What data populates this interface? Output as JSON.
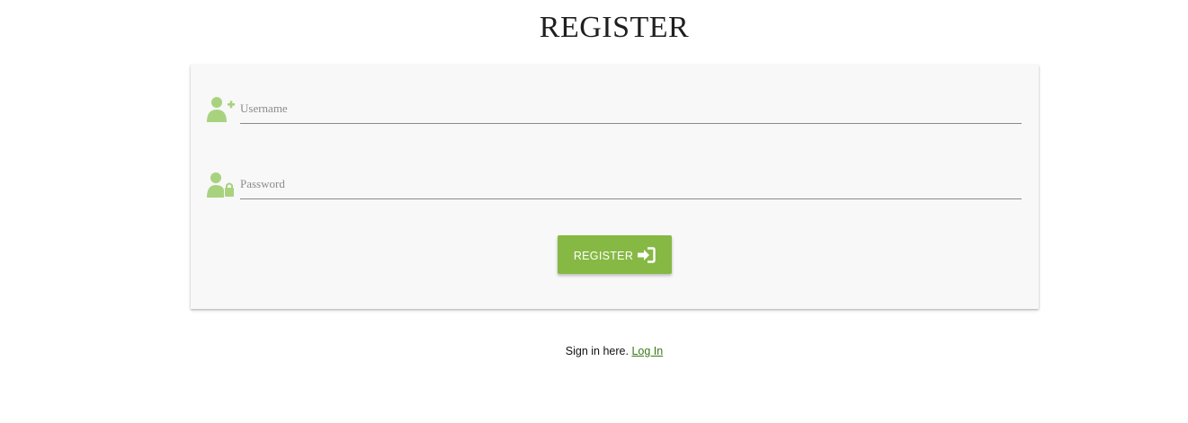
{
  "page": {
    "title": "REGISTER"
  },
  "form": {
    "username": {
      "placeholder": "Username",
      "value": "",
      "icon": "user-plus-icon"
    },
    "password": {
      "placeholder": "Password",
      "value": "",
      "icon": "user-lock-icon"
    },
    "submit": {
      "label": "REGISTER",
      "icon": "sign-in-icon"
    }
  },
  "footer": {
    "text": "Sign in here.",
    "link_label": "Log In"
  },
  "colors": {
    "accent": "#86b944",
    "icon": "#a9d27e",
    "link": "#3a7a16",
    "card_background": "#f8f8f8"
  }
}
